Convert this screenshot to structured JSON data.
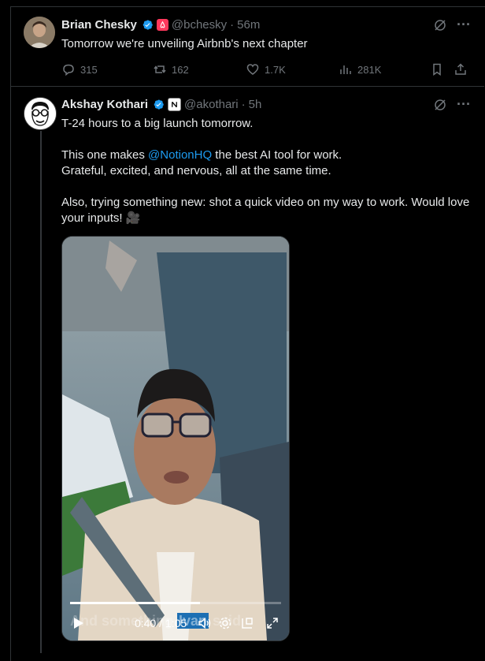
{
  "tweets": [
    {
      "name": "Brian Chesky",
      "handle": "@bchesky",
      "sep": "·",
      "time": "56m",
      "text": "Tomorrow we're unveiling Airbnb's next chapter",
      "actions": {
        "replies": "315",
        "reposts": "162",
        "likes": "1.7K",
        "views": "281K"
      }
    },
    {
      "name": "Akshay Kothari",
      "handle": "@akothari",
      "sep": "·",
      "time": "5h",
      "line1": "T-24 hours to a big launch tomorrow.",
      "line2_prefix": "This one makes ",
      "mention": "@NotionHQ",
      "line2_suffix": " the best AI tool for work.",
      "line3": "Grateful, excited, and nervous, all at the same time.",
      "line4": "Also, trying something new: shot a quick video on my way to work. Would love your inputs! 🎥",
      "video": {
        "time": "0:40 / 1:05",
        "caption_pre": "And something ",
        "caption_hl": "Ivan",
        "caption_post": " said"
      }
    }
  ],
  "colors": {
    "accent": "#1d9bf0",
    "muted": "#71767b",
    "border": "#2f3336",
    "airbnb": "#ff385c"
  }
}
